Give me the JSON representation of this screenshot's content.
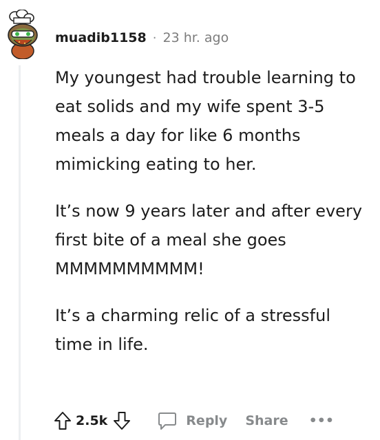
{
  "comment": {
    "username": "muadib1158",
    "separator": "·",
    "timestamp": "23 hr. ago",
    "paragraphs": [
      "My youngest had trouble learning to eat solids and my wife spent 3-5 meals a day for like 6 months mimicking eating to her.",
      "It’s now 9 years later and after every first bite of a meal she goes MMMMMMMMMM!",
      "It’s a charming relic of a stressful time in life."
    ]
  },
  "actions": {
    "vote_count": "2.5k",
    "reply_label": "Reply",
    "share_label": "Share",
    "more_label": "•••"
  },
  "icons": {
    "upvote": "upvote-arrow-icon",
    "downvote": "downvote-arrow-icon",
    "reply": "speech-bubble-icon"
  },
  "colors": {
    "text": "#1c1c1c",
    "muted": "#878a8c",
    "thread_line": "#edeff1"
  }
}
